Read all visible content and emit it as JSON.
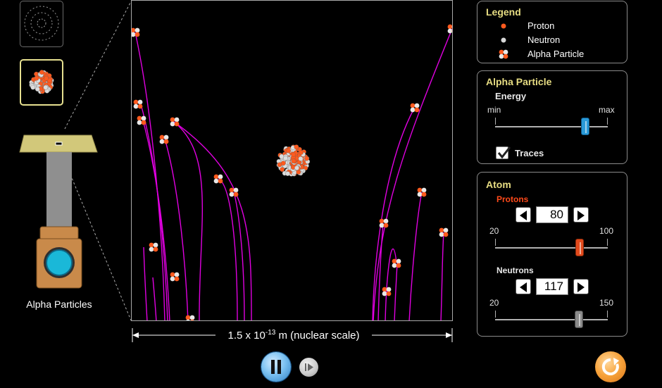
{
  "view_selector": {
    "atom_icon": "atom-orbit-icon",
    "nucleus_icon": "nucleus-icon"
  },
  "gun": {
    "label": "Alpha Particles"
  },
  "stage": {
    "scale_label": "1.5 x 10",
    "scale_exp": "-13",
    "scale_unit": " m (nuclear scale)"
  },
  "legend": {
    "title": "Legend",
    "items": [
      {
        "label": "Proton",
        "color": "#ff5a1e"
      },
      {
        "label": "Neutron",
        "color": "#d8d8d8"
      },
      {
        "label": "Alpha Particle"
      }
    ]
  },
  "alpha_panel": {
    "title": "Alpha Particle",
    "energy_label": "Energy",
    "min_label": "min",
    "max_label": "max",
    "energy_level": 0.8,
    "traces_label": "Traces",
    "traces_checked": true
  },
  "atom_panel": {
    "title": "Atom",
    "protons_label": "Protons",
    "protons_value": "80",
    "protons_min": "20",
    "protons_max": "100",
    "neutrons_label": "Neutrons",
    "neutrons_value": "117",
    "neutrons_min": "20",
    "neutrons_max": "150"
  },
  "controls": {
    "pause_icon": "pause-icon",
    "step_icon": "step-forward-icon",
    "reset_icon": "reset-icon"
  },
  "colors": {
    "trace": "#e000e0",
    "panel_title": "#e6dc82",
    "protons_label": "#ff4a1a",
    "energy_thumb": "#2a9ad8",
    "protons_thumb": "#e24a1c",
    "neutrons_thumb": "#8a8a8a"
  }
}
